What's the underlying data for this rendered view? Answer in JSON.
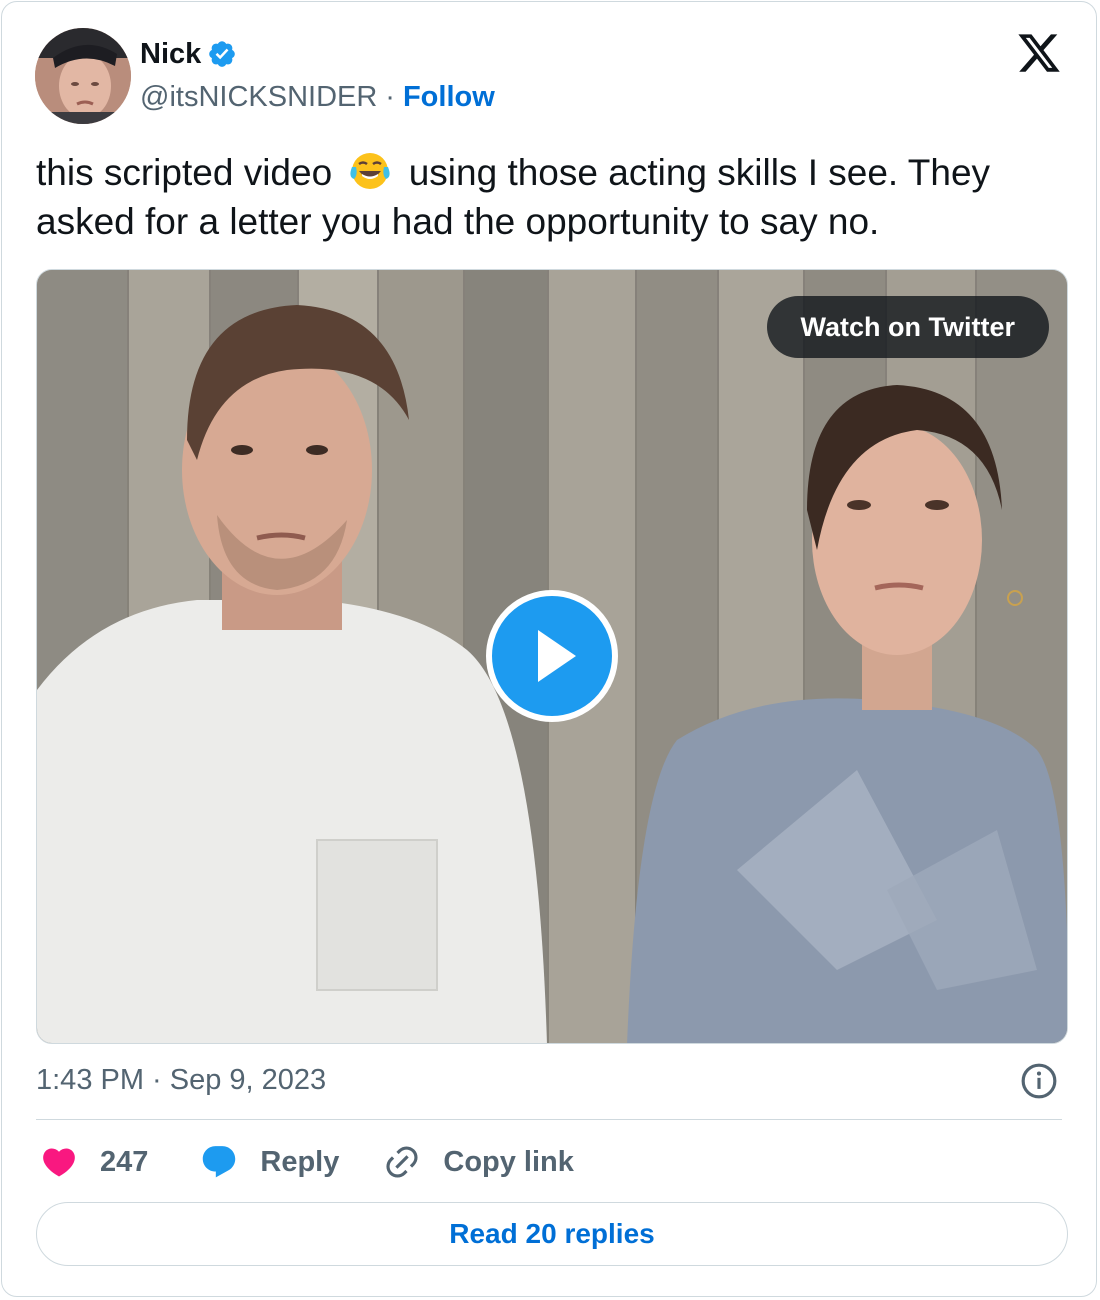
{
  "author": {
    "name": "Nick",
    "handle": "@itsNICKSNIDER",
    "separator": "·",
    "follow_label": "Follow",
    "verified": true
  },
  "tweet": {
    "text_before_emoji": "this scripted video",
    "emoji": "face-with-tears-of-joy",
    "text_after_emoji": "using those acting skills I see. They asked for a letter you had the opportunity to say no."
  },
  "media": {
    "watch_label": "Watch on Twitter",
    "play_icon": "play-icon"
  },
  "meta": {
    "timestamp": "1:43 PM · Sep 9, 2023"
  },
  "actions": {
    "like_count": "247",
    "reply_label": "Reply",
    "copy_link_label": "Copy link"
  },
  "footer": {
    "read_replies_label": "Read 20 replies"
  },
  "colors": {
    "link_blue": "#006fd6",
    "verified_blue": "#1d9bf0",
    "like_pink": "#f91880",
    "secondary_text": "#536471",
    "border": "#cfd9de"
  }
}
